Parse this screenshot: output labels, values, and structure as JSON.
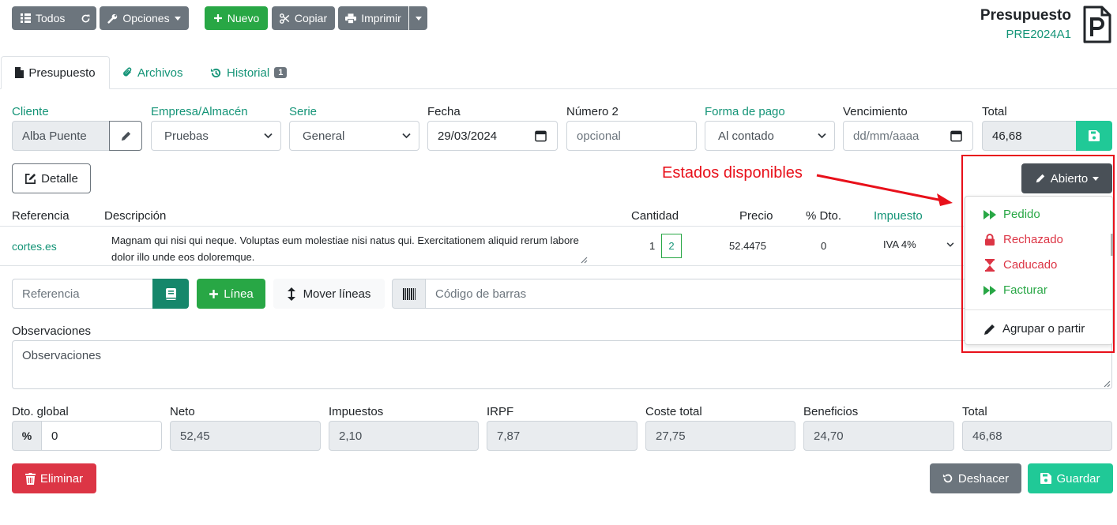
{
  "toolbar": {
    "todos": "Todos",
    "opciones": "Opciones",
    "nuevo": "Nuevo",
    "copiar": "Copiar",
    "imprimir": "Imprimir"
  },
  "doc": {
    "title": "Presupuesto",
    "code": "PRE2024A1"
  },
  "tabs": [
    {
      "label": "Presupuesto"
    },
    {
      "label": "Archivos"
    },
    {
      "label": "Historial",
      "badge": "1"
    }
  ],
  "header_fields": {
    "cliente_label": "Cliente",
    "cliente_value": "Alba Puente",
    "empresa_label": "Empresa/Almacén",
    "empresa_value": "Pruebas",
    "serie_label": "Serie",
    "serie_value": "General",
    "fecha_label": "Fecha",
    "fecha_value": "29/03/2024",
    "numero2_label": "Número 2",
    "numero2_placeholder": "opcional",
    "forma_pago_label": "Forma de pago",
    "forma_pago_value": "Al contado",
    "vencimiento_label": "Vencimiento",
    "vencimiento_placeholder": "dd/mm/aaaa",
    "total_label": "Total",
    "total_value": "46,68"
  },
  "detalle_label": "Detalle",
  "annotation": "Estados disponibles",
  "status_button": "Abierto",
  "status_menu": [
    {
      "label": "Pedido",
      "color": "#28a745",
      "icon": "forward-icon"
    },
    {
      "label": "Rechazado",
      "color": "#dc3545",
      "icon": "lock-icon"
    },
    {
      "label": "Caducado",
      "color": "#dc3545",
      "icon": "hourglass-icon"
    },
    {
      "label": "Facturar",
      "color": "#28a745",
      "icon": "forward-icon"
    },
    {
      "label": "Agrupar o partir",
      "color": "#212529",
      "icon": "pencil-icon"
    }
  ],
  "lines_table": {
    "headers": {
      "referencia": "Referencia",
      "descripcion": "Descripción",
      "cantidad": "Cantidad",
      "precio": "Precio",
      "dto": "% Dto.",
      "impuesto": "Impuesto"
    },
    "rows": [
      {
        "referencia": "cortes.es",
        "descripcion": "Magnam qui nisi qui neque. Voluptas eum molestiae nisi natus qui. Exercitationem aliquid rerum labore dolor illo unde eos doloremque.",
        "cantidad_left": "1",
        "cantidad_box": "2",
        "precio": "52.4475",
        "dto": "0",
        "impuesto": "IVA 4%"
      }
    ]
  },
  "add_line": {
    "referencia_placeholder": "Referencia",
    "linea_button": "Línea",
    "mover_button": "Mover líneas",
    "barcode_placeholder": "Código de barras"
  },
  "observaciones": {
    "label": "Observaciones",
    "placeholder": "Observaciones"
  },
  "totals": {
    "dto_global_label": "Dto. global",
    "dto_global_value": "0",
    "neto_label": "Neto",
    "neto_value": "52,45",
    "impuestos_label": "Impuestos",
    "impuestos_value": "2,10",
    "irpf_label": "IRPF",
    "irpf_value": "7,87",
    "coste_label": "Coste total",
    "coste_value": "27,75",
    "beneficios_label": "Beneficios",
    "beneficios_value": "24,70",
    "total_label": "Total",
    "total_value": "46,68"
  },
  "footer": {
    "eliminar": "Eliminar",
    "deshacer": "Deshacer",
    "guardar": "Guardar"
  }
}
